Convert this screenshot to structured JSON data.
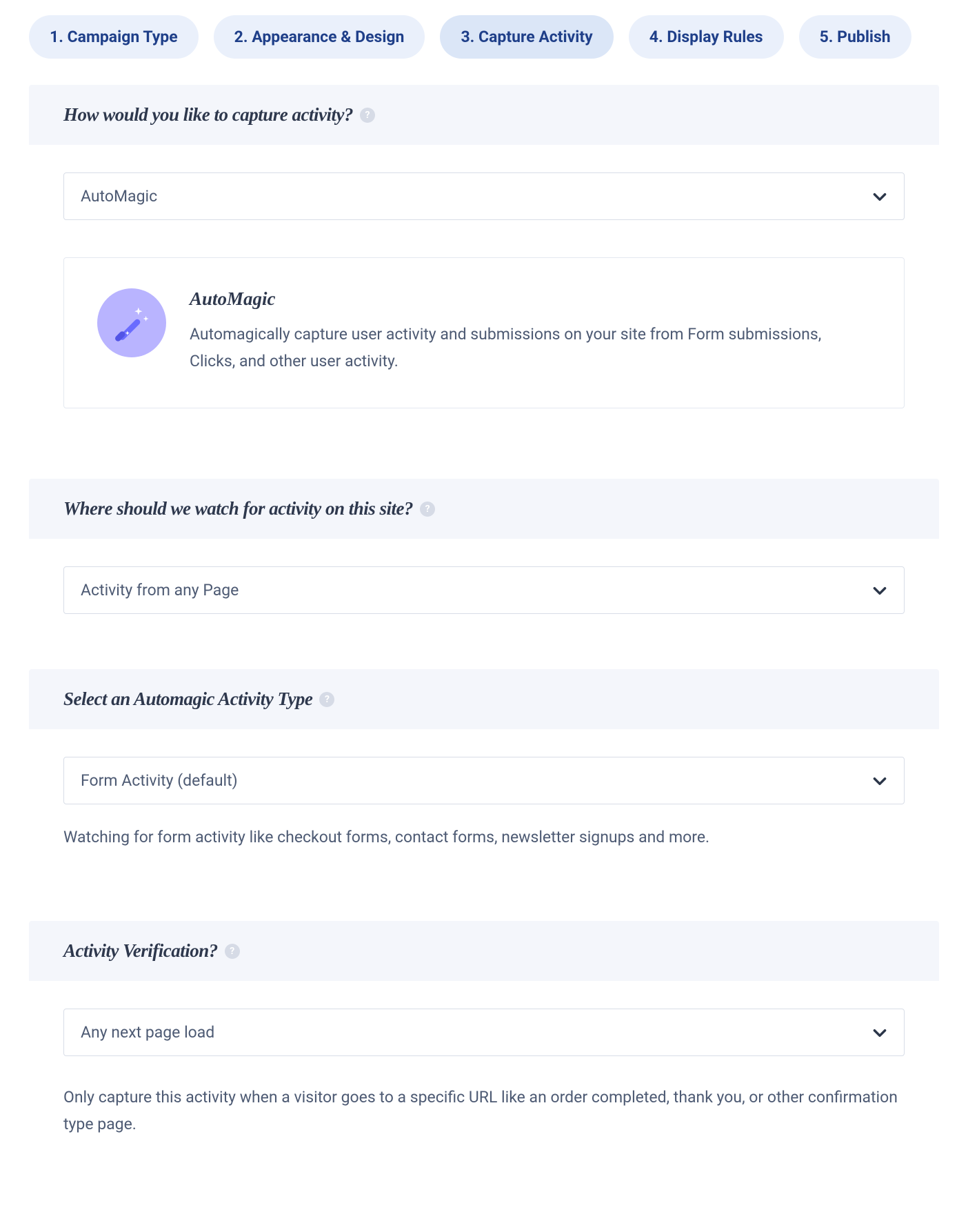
{
  "tabs": [
    {
      "label": "1. Campaign Type",
      "active": false
    },
    {
      "label": "2. Appearance & Design",
      "active": false
    },
    {
      "label": "3. Capture Activity",
      "active": true
    },
    {
      "label": "4. Display Rules",
      "active": false
    },
    {
      "label": "5. Publish",
      "active": false
    }
  ],
  "sections": {
    "capture": {
      "title": "How would you like to capture activity?",
      "select_value": "AutoMagic",
      "card_title": "AutoMagic",
      "card_desc": "Automagically capture user activity and submissions on your site from Form submissions, Clicks, and other user activity."
    },
    "watch": {
      "title": "Where should we watch for activity on this site?",
      "select_value": "Activity from any Page"
    },
    "type": {
      "title": "Select an Automagic Activity Type",
      "select_value": "Form Activity (default)",
      "helper": "Watching for form activity like checkout forms, contact forms, newsletter signups and more."
    },
    "verify": {
      "title": "Activity Verification?",
      "select_value": "Any next page load",
      "helper": "Only capture this activity when a visitor goes to a specific URL like an order completed, thank you, or other confirmation type page."
    }
  }
}
